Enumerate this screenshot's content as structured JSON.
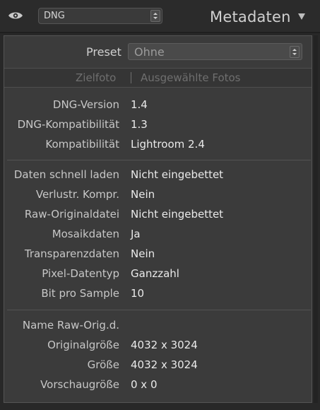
{
  "header": {
    "preset_value": "DNG",
    "title": "Metadaten",
    "icons": [
      "eye-icon",
      "collapse-triangle-icon"
    ]
  },
  "preset": {
    "label": "Preset",
    "value": "Ohne"
  },
  "tabs": {
    "target": "Zielfoto",
    "selected": "Ausgewählte Fotos"
  },
  "groups": [
    {
      "rows": [
        {
          "label": "DNG-Version",
          "value": "1.4"
        },
        {
          "label": "DNG-Kompatibilität",
          "value": "1.3"
        },
        {
          "label": "Kompatibilität",
          "value": "Lightroom 2.4"
        }
      ]
    },
    {
      "rows": [
        {
          "label": "Daten schnell laden",
          "value": "Nicht eingebettet"
        },
        {
          "label": "Verlustr. Kompr.",
          "value": "Nein"
        },
        {
          "label": "Raw-Originaldatei",
          "value": "Nicht eingebettet"
        },
        {
          "label": "Mosaikdaten",
          "value": "Ja"
        },
        {
          "label": "Transparenzdaten",
          "value": "Nein"
        },
        {
          "label": "Pixel-Datentyp",
          "value": "Ganzzahl"
        },
        {
          "label": "Bit pro Sample",
          "value": "10"
        }
      ]
    },
    {
      "rows": [
        {
          "label": "Name Raw-Orig.d.",
          "value": ""
        },
        {
          "label": "Originalgröße",
          "value": "4032 x 3024"
        },
        {
          "label": "Größe",
          "value": "4032 x 3024"
        },
        {
          "label": "Vorschaugröße",
          "value": "0 x 0"
        }
      ]
    }
  ]
}
